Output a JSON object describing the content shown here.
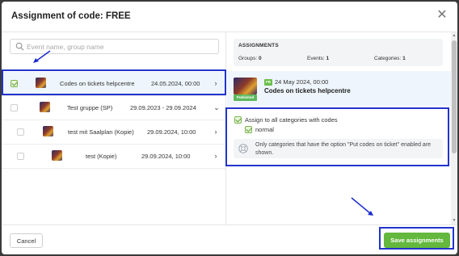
{
  "dialog": {
    "title": "Assignment of code: FREE",
    "close_icon": "close-icon"
  },
  "search": {
    "placeholder": "Event name, group name",
    "value": ""
  },
  "events": [
    {
      "name": "Codes on tickets helpcentre",
      "date": "24.05.2024, 00:00",
      "checked": true,
      "chevron": "›"
    },
    {
      "name": "Test gruppe (SP)",
      "date": "29.09.2023 - 29.09.2024",
      "checked": false,
      "chevron": "⌄"
    },
    {
      "name": "test mit Saalplan (Kopie)",
      "date": "29.09.2024, 10:00",
      "checked": false,
      "chevron": "›"
    },
    {
      "name": "test (Kopie)",
      "date": "29.09.2024, 10:00",
      "checked": false,
      "chevron": "›"
    }
  ],
  "summary": {
    "title": "ASSIGNMENTS",
    "groups_label": "Groups:",
    "groups_value": "0",
    "events_label": "Events:",
    "events_value": "1",
    "categories_label": "Categories:",
    "categories_value": "1"
  },
  "selected_event": {
    "badge_lang": "FR",
    "date": "24 May 2024, 00:00",
    "name": "Codes on tickets helpcentre",
    "badge_status": "Published"
  },
  "assignment": {
    "all_categories_label": "Assign to all categories with codes",
    "category_label": "normal",
    "info_text": "Only categories that have the option \"Put codes on ticket\" enabled are shown."
  },
  "footer": {
    "cancel_label": "Cancel",
    "save_label": "Save assignments"
  },
  "colors": {
    "highlight": "#2233cc",
    "accent": "#63b83d",
    "selected_bg": "#eef5fc"
  }
}
